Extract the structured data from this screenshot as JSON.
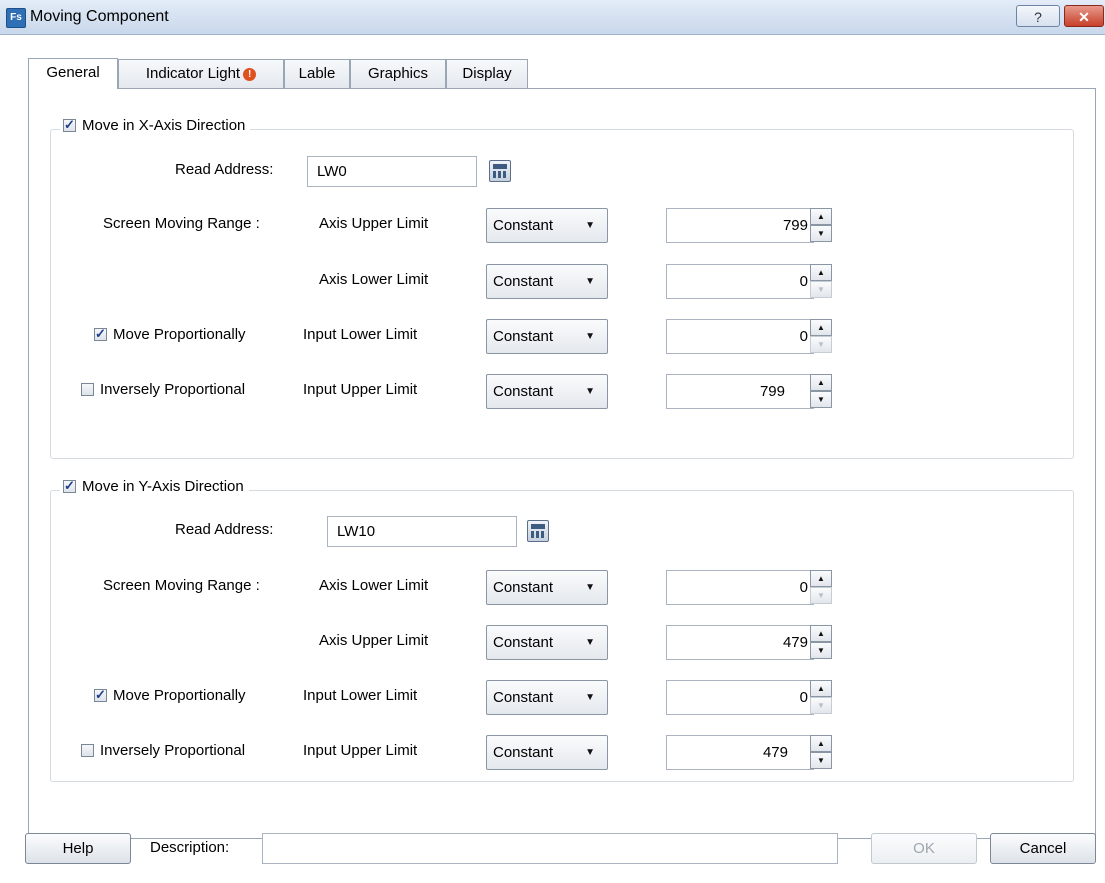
{
  "window": {
    "title": "Moving Component",
    "app_icon_text": "Fs",
    "help_button": "?",
    "close_button": "✕"
  },
  "tabs": [
    {
      "label": "General",
      "active": true
    },
    {
      "label": "Indicator Light",
      "has_alert": true
    },
    {
      "label": "Lable"
    },
    {
      "label": "Graphics"
    },
    {
      "label": "Display"
    }
  ],
  "x_axis": {
    "enable_label": "Move in X-Axis Direction",
    "enabled": true,
    "read_address_label": "Read Address:",
    "read_address": "LW0",
    "screen_moving_range_label": "Screen Moving Range :",
    "rows": [
      {
        "limit_label": "Axis Upper Limit",
        "mode": "Constant",
        "value": "799"
      },
      {
        "limit_label": "Axis Lower Limit",
        "mode": "Constant",
        "value": "0"
      },
      {
        "limit_label": "Input Lower Limit",
        "mode": "Constant",
        "value": "0"
      },
      {
        "limit_label": "Input Upper Limit",
        "mode": "Constant",
        "value": "799"
      }
    ],
    "move_proportionally_label": "Move Proportionally",
    "move_proportionally": true,
    "inversely_proportional_label": "Inversely Proportional",
    "inversely_proportional": false
  },
  "y_axis": {
    "enable_label": "Move in Y-Axis Direction",
    "enabled": true,
    "read_address_label": "Read Address:",
    "read_address": "LW10",
    "screen_moving_range_label": "Screen Moving Range :",
    "rows": [
      {
        "limit_label": "Axis Lower Limit",
        "mode": "Constant",
        "value": "0"
      },
      {
        "limit_label": "Axis Upper Limit",
        "mode": "Constant",
        "value": "479"
      },
      {
        "limit_label": "Input Lower Limit",
        "mode": "Constant",
        "value": "0"
      },
      {
        "limit_label": "Input Upper Limit",
        "mode": "Constant",
        "value": "479"
      }
    ],
    "move_proportionally_label": "Move Proportionally",
    "move_proportionally": true,
    "inversely_proportional_label": "Inversely Proportional",
    "inversely_proportional": false
  },
  "footer": {
    "help_label": "Help",
    "description_label": "Description:",
    "description_value": "",
    "ok_label": "OK",
    "cancel_label": "Cancel"
  }
}
